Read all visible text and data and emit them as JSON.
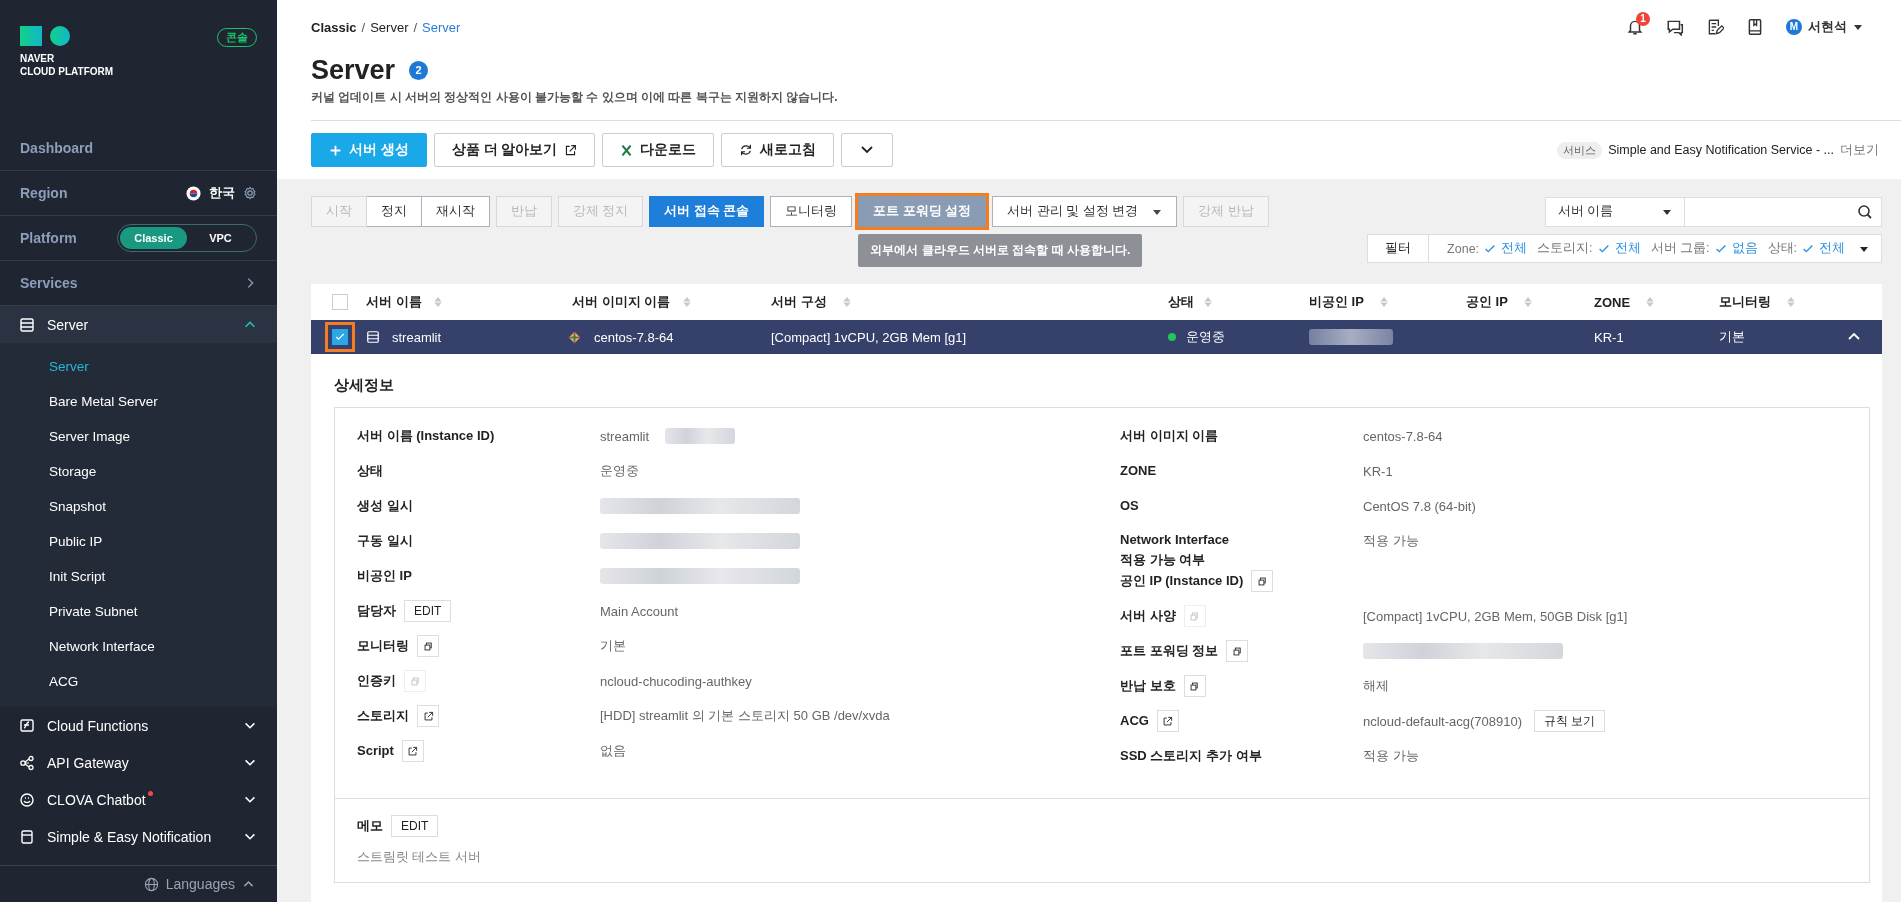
{
  "sidebar": {
    "logo": {
      "line1": "NAVER",
      "line2": "CLOUD PLATFORM"
    },
    "console_badge": "콘솔",
    "dashboard": "Dashboard",
    "region": {
      "label": "Region",
      "value": "한국"
    },
    "platform": {
      "label": "Platform",
      "options": [
        {
          "label": "Classic",
          "selected": true
        },
        {
          "label": "VPC",
          "selected": false
        }
      ]
    },
    "services": "Services",
    "menu": [
      {
        "label": "Server",
        "expanded": true,
        "new": false,
        "children": [
          {
            "label": "Server",
            "selected": true
          },
          {
            "label": "Bare Metal Server",
            "selected": false
          },
          {
            "label": "Server Image",
            "selected": false
          },
          {
            "label": "Storage",
            "selected": false
          },
          {
            "label": "Snapshot",
            "selected": false
          },
          {
            "label": "Public IP",
            "selected": false
          },
          {
            "label": "Init Script",
            "selected": false
          },
          {
            "label": "Private Subnet",
            "selected": false
          },
          {
            "label": "Network Interface",
            "selected": false
          },
          {
            "label": "ACG",
            "selected": false
          }
        ]
      },
      {
        "label": "Cloud Functions",
        "expanded": false,
        "new": false
      },
      {
        "label": "API Gateway",
        "expanded": false,
        "new": false
      },
      {
        "label": "CLOVA Chatbot",
        "expanded": false,
        "new": true
      },
      {
        "label": "Simple & Easy Notification",
        "expanded": false,
        "new": false
      }
    ],
    "languages": "Languages"
  },
  "header": {
    "breadcrumb": [
      {
        "label": "Classic",
        "kind": "root",
        "separator": "/"
      },
      {
        "label": "Server",
        "kind": "path",
        "separator": "/"
      },
      {
        "label": "Server",
        "kind": "current"
      }
    ],
    "notification_count": "1",
    "user": {
      "initial": "M",
      "name": "서현석"
    },
    "title": "Server",
    "count": "2",
    "notice": "커널 업데이트 시 서버의 정상적인 사용이 불가능할 수 있으며 이에 따른 복구는 지원하지 않습니다."
  },
  "toolbar": {
    "buttons": [
      {
        "label": "서버 생성",
        "kind": "primary"
      },
      {
        "label": "상품 더 알아보기",
        "kind": "external"
      },
      {
        "label": "다운로드",
        "kind": "excel"
      },
      {
        "label": "새로고침",
        "kind": "refresh"
      },
      {
        "kind": "more"
      }
    ],
    "service": {
      "tag": "서비스",
      "text": "Simple and Easy Notification Service - ...",
      "link": "더보기"
    }
  },
  "actions": [
    [
      {
        "label": "시작",
        "disabled": true,
        "kind": "plain"
      },
      {
        "label": "정지",
        "disabled": false,
        "kind": "plain"
      },
      {
        "label": "재시작",
        "disabled": false,
        "kind": "plain"
      }
    ],
    [
      {
        "label": "반납",
        "disabled": true,
        "kind": "plain"
      }
    ],
    [
      {
        "label": "강제 정지",
        "disabled": true,
        "kind": "plain"
      }
    ],
    [
      {
        "label": "서버 접속 콘솔",
        "disabled": false,
        "kind": "primary"
      }
    ],
    [
      {
        "label": "모니터링",
        "disabled": false,
        "kind": "plain"
      }
    ],
    [
      {
        "label": "포트 포워딩 설정",
        "disabled": false,
        "kind": "highlighted",
        "tooltip": "외부에서 클라우드 서버로 접속할 때 사용합니다."
      }
    ],
    [
      {
        "label": "서버 관리 및 설정 변경",
        "disabled": false,
        "kind": "dropdown"
      }
    ],
    [
      {
        "label": "강제 반납",
        "disabled": true,
        "kind": "plain"
      }
    ]
  ],
  "search": {
    "field": "서버 이름"
  },
  "filter": {
    "label": "필터",
    "items": [
      {
        "label": "Zone:",
        "value": "전체"
      },
      {
        "label": "스토리지:",
        "value": "전체"
      },
      {
        "label": "서버 그룹:",
        "value": "없음"
      },
      {
        "label": "상태:",
        "value": "전체"
      }
    ]
  },
  "table": {
    "header_checked": false,
    "columns": [
      "서버 이름",
      "서버 이미지 이름",
      "서버 구성",
      "상태",
      "비공인 IP",
      "공인 IP",
      "ZONE",
      "모니터링"
    ],
    "rows": [
      {
        "checked": true,
        "highlighted": true,
        "selected": true,
        "expanded": true,
        "name": "streamlit",
        "image": "centos-7.8-64",
        "config": "[Compact] 1vCPU, 2GB Mem [g1]",
        "status": "운영중",
        "color": "#22c55e",
        "private_ip_redacted": true,
        "zone": "KR-1",
        "monitoring": "기본"
      }
    ]
  },
  "details": {
    "title": "상세정보",
    "left": [
      {
        "label": "서버 이름 (Instance ID)",
        "value": "streamlit",
        "redacted": true
      },
      {
        "label": "상태",
        "value": "운영중"
      },
      {
        "label": "생성 일시",
        "redacted": true
      },
      {
        "label": "구동 일시",
        "redacted": true
      },
      {
        "label": "비공인 IP",
        "redacted": true
      },
      {
        "label": "담당자",
        "action": {
          "kind": "edit",
          "label": "EDIT"
        },
        "value": "Main Account"
      },
      {
        "label": "모니터링",
        "action": {
          "kind": "copy",
          "disabled": false
        },
        "value": "기본"
      },
      {
        "label": "인증키",
        "action": {
          "kind": "copy",
          "disabled": true
        },
        "value": "ncloud-chucoding-authkey"
      },
      {
        "label": "스토리지",
        "action": {
          "kind": "external",
          "disabled": false
        },
        "value": "[HDD] streamlit 의 기본 스토리지  50 GB /dev/xvda"
      },
      {
        "label": "Script",
        "action": {
          "kind": "external",
          "disabled": false
        },
        "value": "없음"
      }
    ],
    "right": [
      {
        "label": "서버 이미지 이름",
        "value": "centos-7.8-64"
      },
      {
        "label": "ZONE",
        "value": "KR-1"
      },
      {
        "label": "OS",
        "value": "CentOS 7.8 (64-bit)"
      },
      {
        "label": "Network Interface\n적용 가능 여부",
        "value": "적용 가능"
      },
      {
        "label": "공인 IP (Instance ID)",
        "action": {
          "kind": "copy",
          "disabled": false
        }
      },
      {
        "label": "서버 사양",
        "action": {
          "kind": "copy",
          "disabled": true
        },
        "value": "[Compact] 1vCPU, 2GB Mem, 50GB Disk [g1]"
      },
      {
        "label": "포트 포워딩 정보",
        "action": {
          "kind": "copy",
          "disabled": false
        },
        "redacted": true
      },
      {
        "label": "반납 보호",
        "action": {
          "kind": "copy",
          "disabled": false
        },
        "value": "해제"
      },
      {
        "label": "ACG",
        "action": {
          "kind": "external",
          "disabled": false
        },
        "value": "ncloud-default-acg(708910)",
        "button": "규칙 보기"
      },
      {
        "label": "SSD 스토리지 추가 여부",
        "value": "적용 가능"
      }
    ],
    "memo": {
      "label": "메모",
      "button": "EDIT",
      "text": "스트림릿 테스트 서버"
    }
  }
}
